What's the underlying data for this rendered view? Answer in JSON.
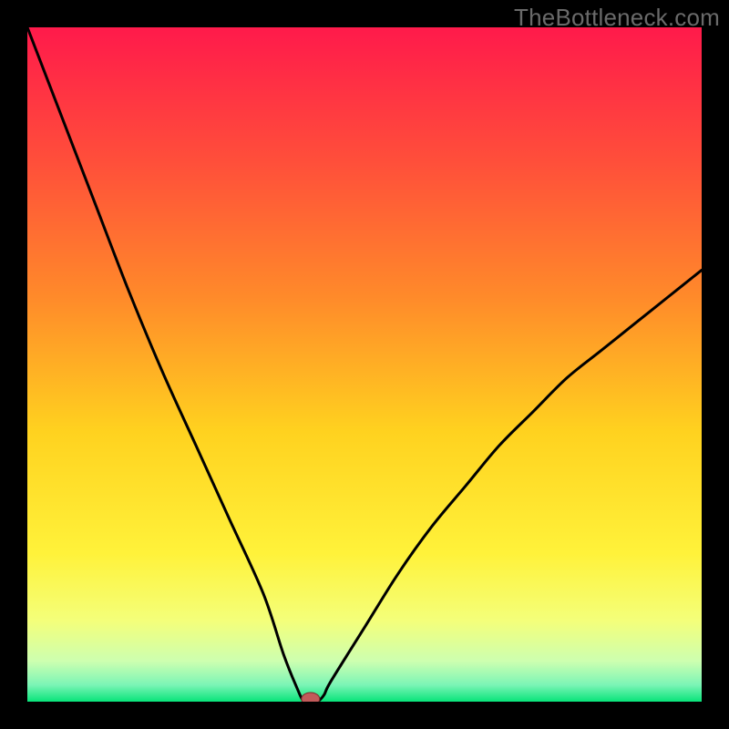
{
  "watermark": "TheBottleneck.com",
  "chart_data": {
    "type": "line",
    "title": "",
    "xlabel": "",
    "ylabel": "",
    "xlim": [
      0,
      100
    ],
    "ylim": [
      0,
      100
    ],
    "grid": false,
    "legend": false,
    "series": [
      {
        "name": "bottleneck-curve",
        "x": [
          0,
          5,
          10,
          15,
          20,
          25,
          30,
          35,
          38,
          40,
          41,
          42,
          43,
          44,
          45,
          50,
          55,
          60,
          65,
          70,
          75,
          80,
          85,
          90,
          95,
          100
        ],
        "y": [
          100,
          87,
          74,
          61,
          49,
          38,
          27,
          16,
          7,
          2,
          0,
          0,
          0,
          1,
          3,
          11,
          19,
          26,
          32,
          38,
          43,
          48,
          52,
          56,
          60,
          64
        ]
      }
    ],
    "marker": {
      "x": 42,
      "y": 0
    },
    "gradient_stops": [
      {
        "offset": 0.0,
        "color": "#ff1a4b"
      },
      {
        "offset": 0.2,
        "color": "#ff4f3a"
      },
      {
        "offset": 0.4,
        "color": "#ff8a2a"
      },
      {
        "offset": 0.6,
        "color": "#ffd21f"
      },
      {
        "offset": 0.78,
        "color": "#fff23a"
      },
      {
        "offset": 0.88,
        "color": "#f4ff7a"
      },
      {
        "offset": 0.94,
        "color": "#cdffb0"
      },
      {
        "offset": 0.975,
        "color": "#7cf5b6"
      },
      {
        "offset": 1.0,
        "color": "#08e47a"
      }
    ]
  }
}
